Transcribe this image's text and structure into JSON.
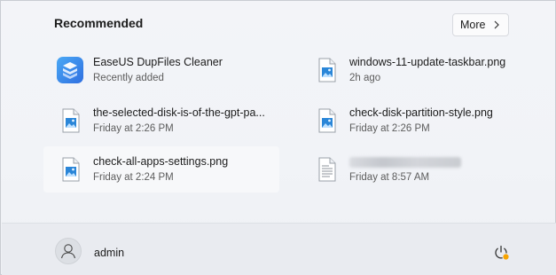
{
  "recommended": {
    "title": "Recommended",
    "more_label": "More"
  },
  "items": [
    {
      "name": "EaseUS DupFiles Cleaner",
      "sub": "Recently added",
      "icon": "app-icon"
    },
    {
      "name": "windows-11-update-taskbar.png",
      "sub": "2h ago",
      "icon": "image-file-icon"
    },
    {
      "name": "the-selected-disk-is-of-the-gpt-pa...",
      "sub": "Friday at 2:26 PM",
      "icon": "image-file-icon"
    },
    {
      "name": "check-disk-partition-style.png",
      "sub": "Friday at 2:26 PM",
      "icon": "image-file-icon"
    },
    {
      "name": "check-all-apps-settings.png",
      "sub": "Friday at 2:24 PM",
      "icon": "image-file-icon"
    },
    {
      "name": "",
      "sub": "Friday at 8:57 AM",
      "icon": "text-file-icon"
    }
  ],
  "footer": {
    "user_name": "admin"
  },
  "colors": {
    "accent": "#0a6fd1",
    "power_badge": "#f7a300"
  }
}
